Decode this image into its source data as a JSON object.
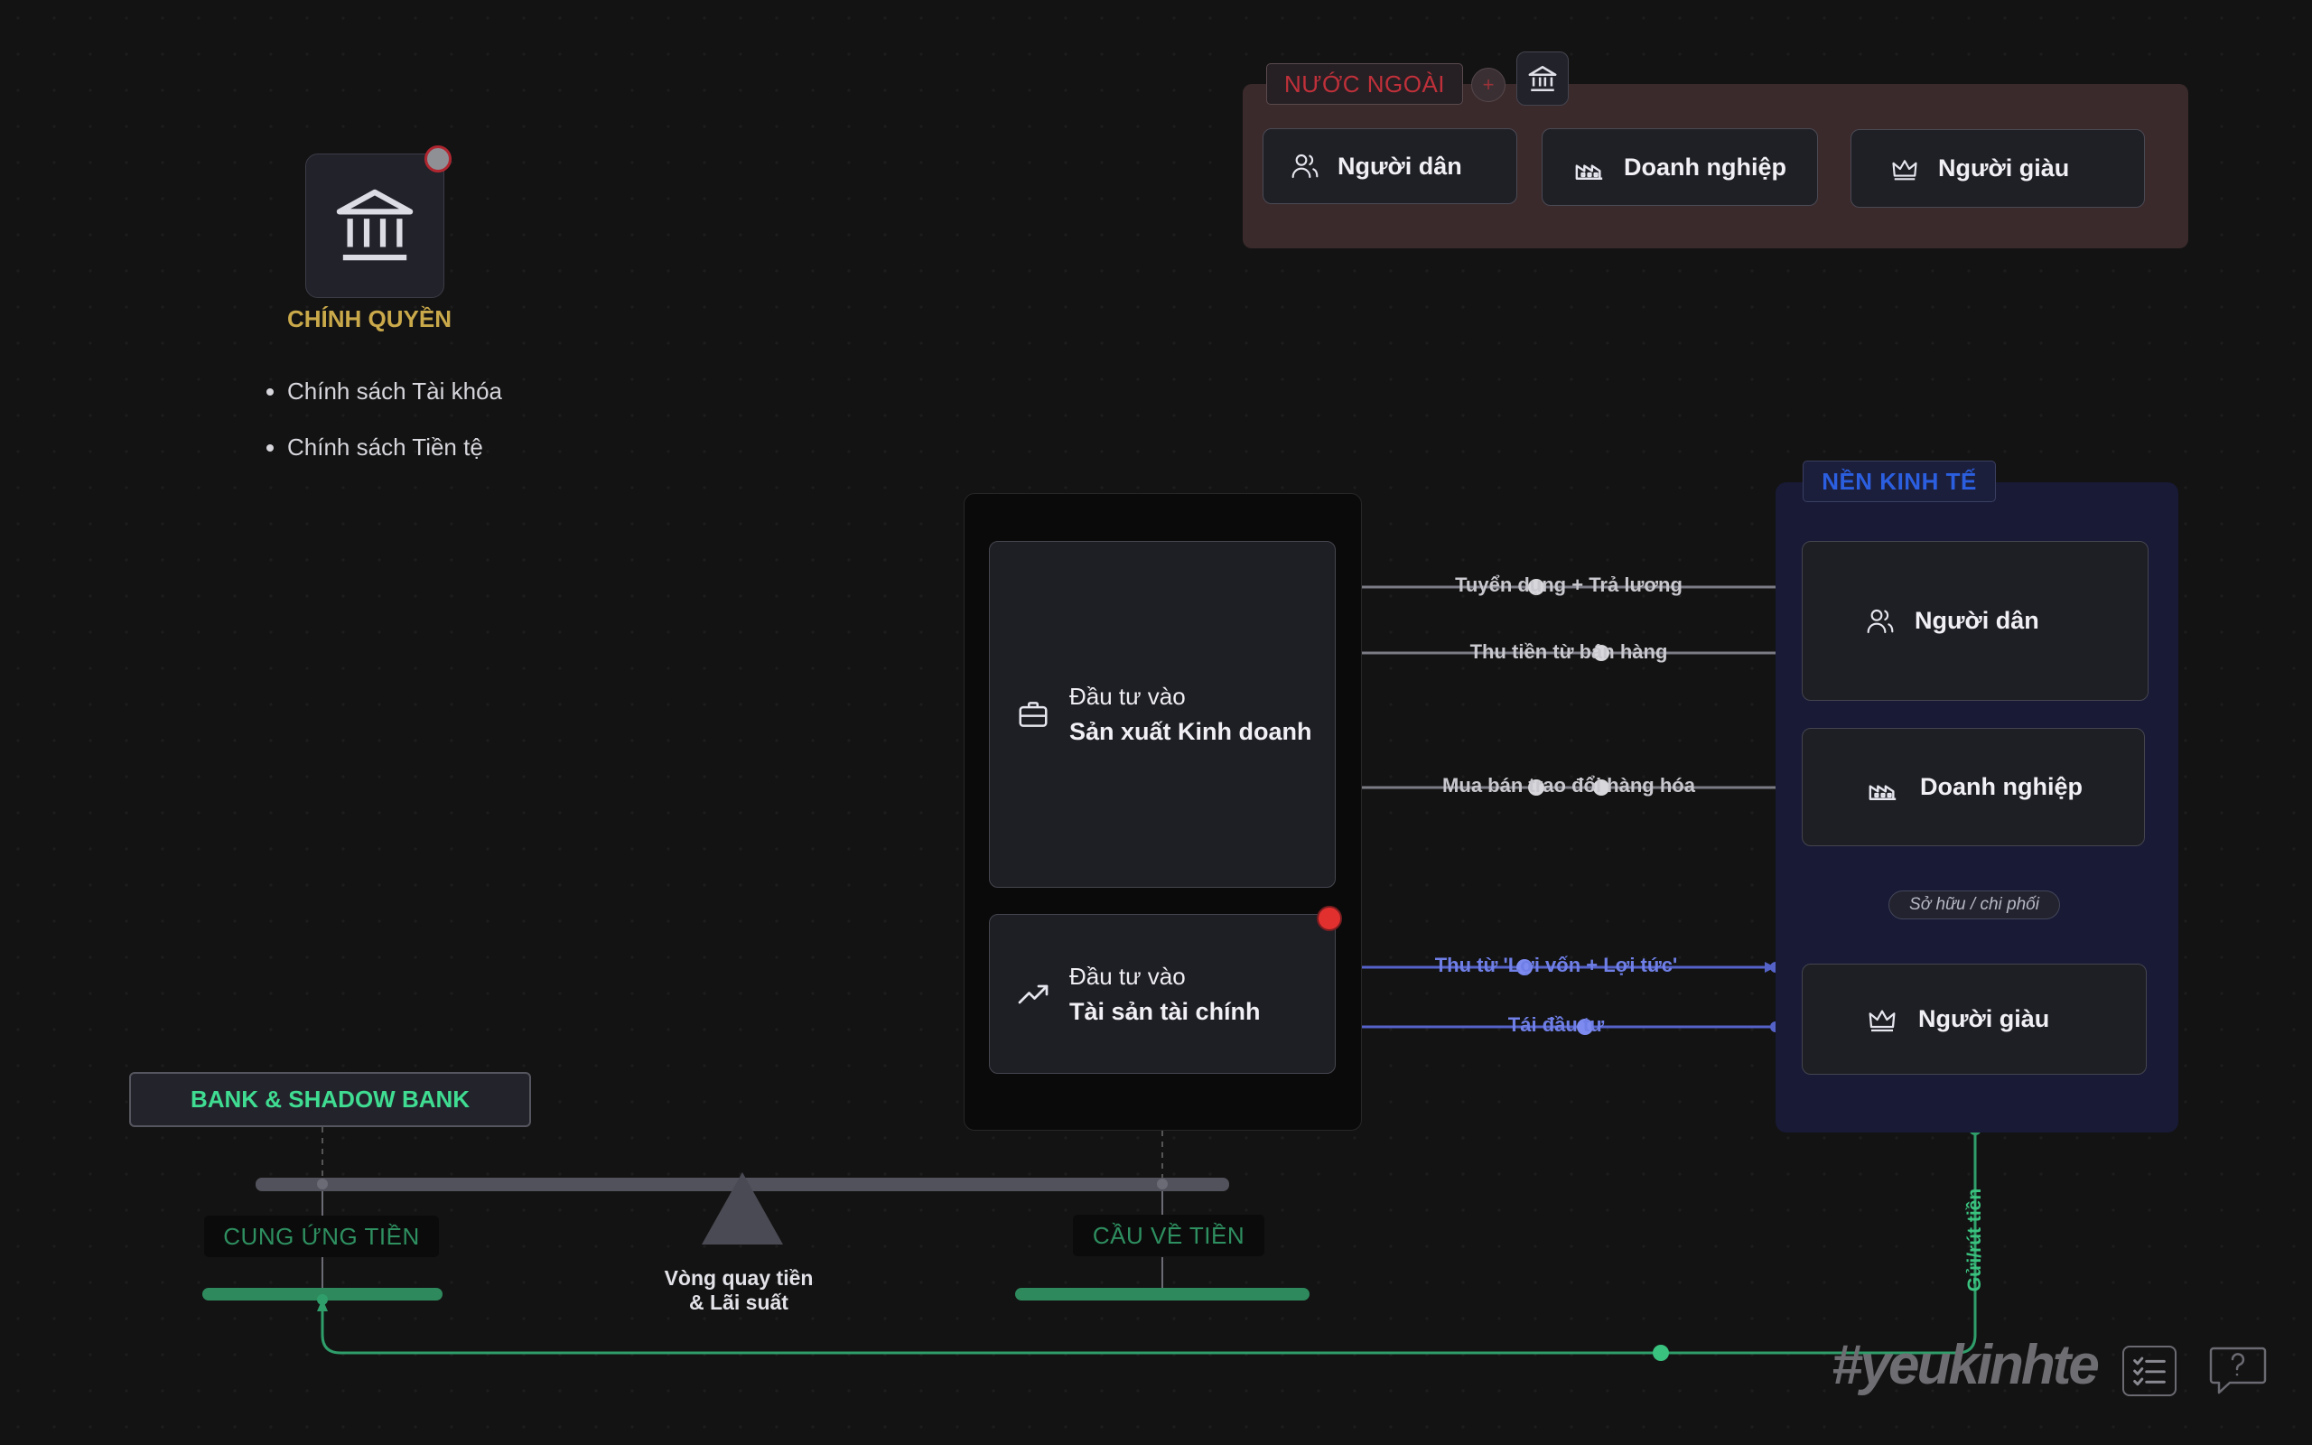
{
  "foreign": {
    "tag": "NƯỚC NGOÀI",
    "plus": "+",
    "items": [
      {
        "label": "Người dân",
        "icon": "people-icon"
      },
      {
        "label": "Doanh nghiệp",
        "icon": "factory-icon"
      },
      {
        "label": "Người giàu",
        "icon": "crown-icon"
      }
    ]
  },
  "government": {
    "title": "CHÍNH QUYỀN",
    "policies": [
      "Chính sách Tài khóa",
      "Chính sách Tiền tệ"
    ]
  },
  "economy": {
    "tag": "NỀN KINH TẾ",
    "people": "Người dân",
    "business": "Doanh nghiệp",
    "rich": "Người giàu",
    "ownership": "Sở hữu / chi phối",
    "deposit": "Gửi/rút tiền"
  },
  "investment": {
    "production_line1": "Đầu tư vào",
    "production_line2": "Sản xuất Kinh doanh",
    "financial_line1": "Đầu tư vào",
    "financial_line2": "Tài sản tài chính"
  },
  "flows": {
    "hire": "Tuyển dụng + Trả lương",
    "sales": "Thu tiền từ bán hàng",
    "trade": "Mua bán trao đổi hàng hóa",
    "capital_gain": "Thu từ 'Lợi vốn + Lợi tức'",
    "reinvest": "Tái đầu tư"
  },
  "bank": {
    "title": "BANK & SHADOW BANK",
    "supply": "CUNG ỨNG TIỀN",
    "demand": "CẦU VỀ TIỀN",
    "pivot_line1": "Vòng quay tiền",
    "pivot_line2": "& Lãi suất"
  },
  "brand": "#yeukinhte",
  "colors": {
    "foreign_tag": "#c0303a",
    "economy_tag": "#2b5fe0",
    "gov_title": "#c9a94a",
    "green": "#3ac27f",
    "blue_flow": "#6f7fe6"
  }
}
